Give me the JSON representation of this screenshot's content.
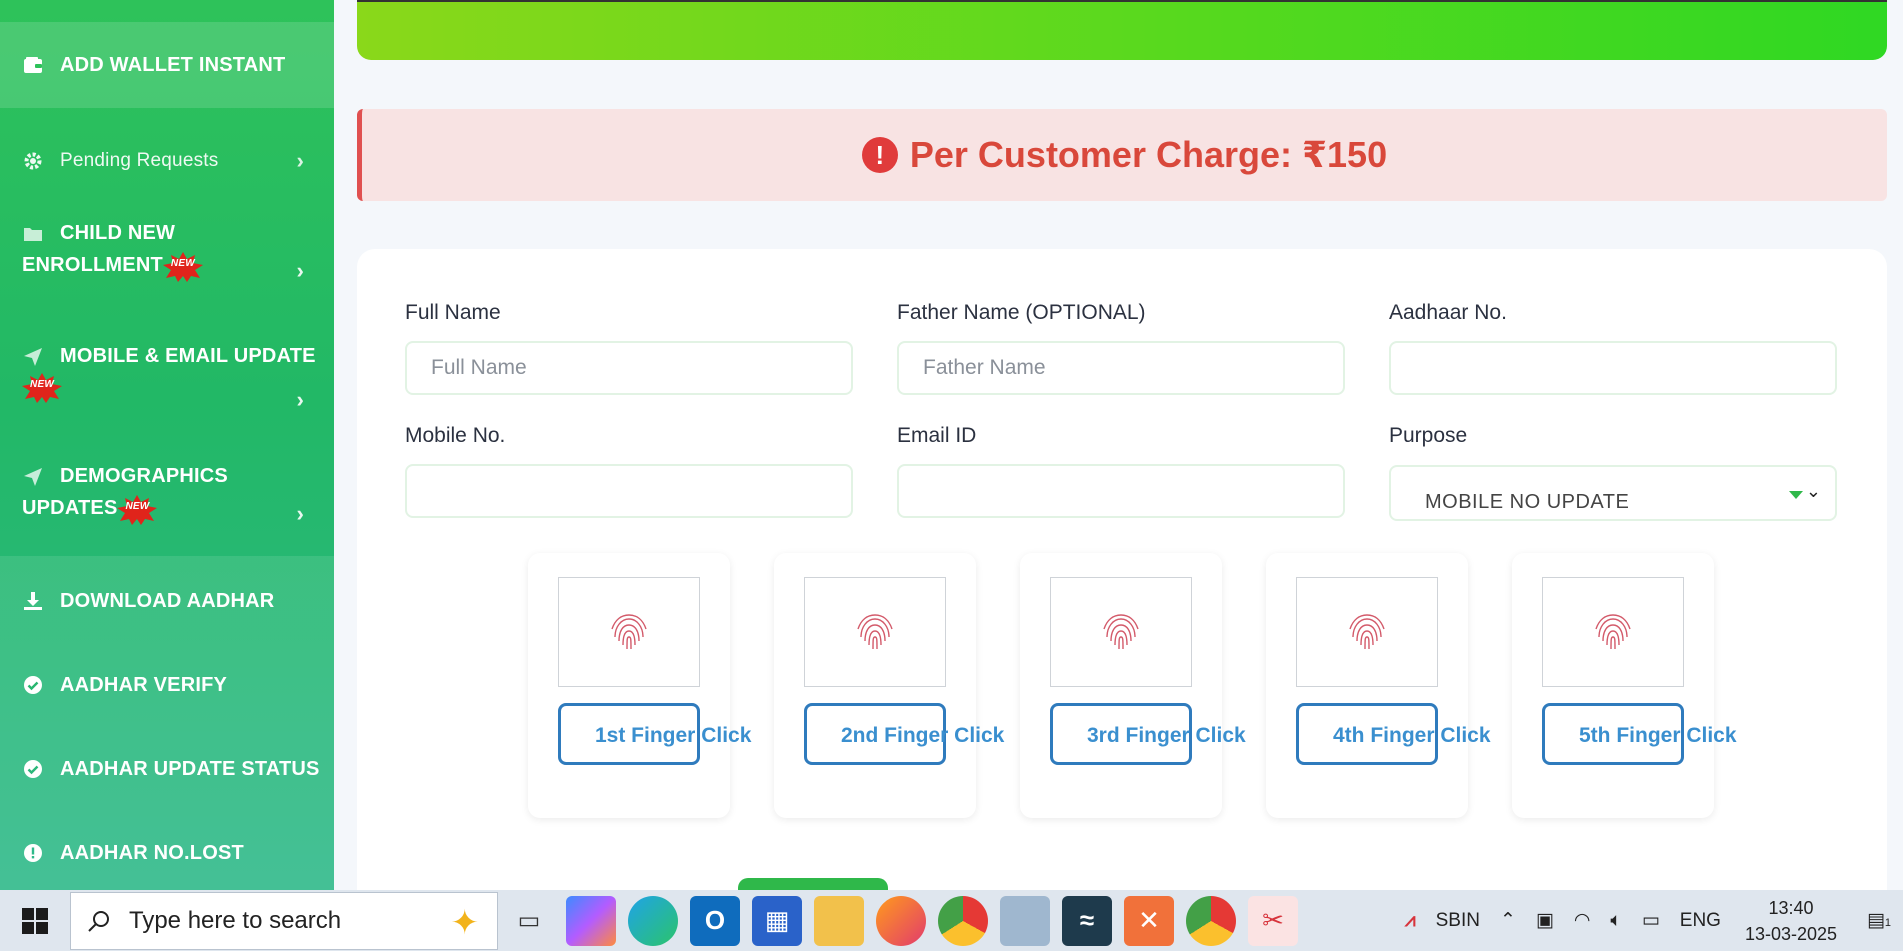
{
  "sidebar": {
    "items": [
      {
        "label": "ADD WALLET INSTANT",
        "icon": "wallet-icon"
      },
      {
        "label": "Pending Requests",
        "icon": "gear-icon"
      },
      {
        "label_line1": "CHILD NEW",
        "label_line2": "ENROLLMENT",
        "icon": "folder-icon",
        "badge": "NEW"
      },
      {
        "label_line1": "MOBILE & EMAIL UPDATE",
        "icon": "paper-plane-icon",
        "badge": "NEW"
      },
      {
        "label_line1": "DEMOGRAPHICS",
        "label_line2": "UPDATES",
        "icon": "paper-plane-icon",
        "badge": "NEW"
      },
      {
        "label": "DOWNLOAD AADHAR",
        "icon": "download-icon"
      },
      {
        "label": "AADHAR VERIFY",
        "icon": "check-circle-icon"
      },
      {
        "label": "AADHAR UPDATE STATUS",
        "icon": "check-circle-icon"
      },
      {
        "label": "AADHAR NO.LOST",
        "icon": "alert-circle-icon"
      }
    ]
  },
  "charge": {
    "text": "Per Customer Charge: ₹150",
    "icon": "exclamation-circle-icon",
    "color": "#d9483b"
  },
  "form": {
    "full_name": {
      "label": "Full Name",
      "placeholder": "Full Name"
    },
    "father_name": {
      "label": "Father Name (OPTIONAL)",
      "placeholder": "Father Name"
    },
    "aadhaar": {
      "label": "Aadhaar No.",
      "placeholder": ""
    },
    "mobile": {
      "label": "Mobile No.",
      "placeholder": ""
    },
    "email": {
      "label": "Email ID",
      "placeholder": ""
    },
    "purpose": {
      "label": "Purpose",
      "value": "MOBILE NO UPDATE"
    }
  },
  "fingers": [
    {
      "label": "1st Finger Click"
    },
    {
      "label": "2nd Finger Click"
    },
    {
      "label": "3rd Finger Click"
    },
    {
      "label": "4th Finger Click"
    },
    {
      "label": "5th Finger Click"
    }
  ],
  "taskbar": {
    "search_placeholder": "Type here to search",
    "tray_label": "SBIN",
    "language": "ENG",
    "time": "13:40",
    "date": "13-03-2025",
    "notification_count": "1"
  },
  "colors": {
    "sidebar": "#22b866",
    "banner": "#56d91e",
    "finger_button": "#2f7bbd",
    "alert": "#e03b3b"
  }
}
